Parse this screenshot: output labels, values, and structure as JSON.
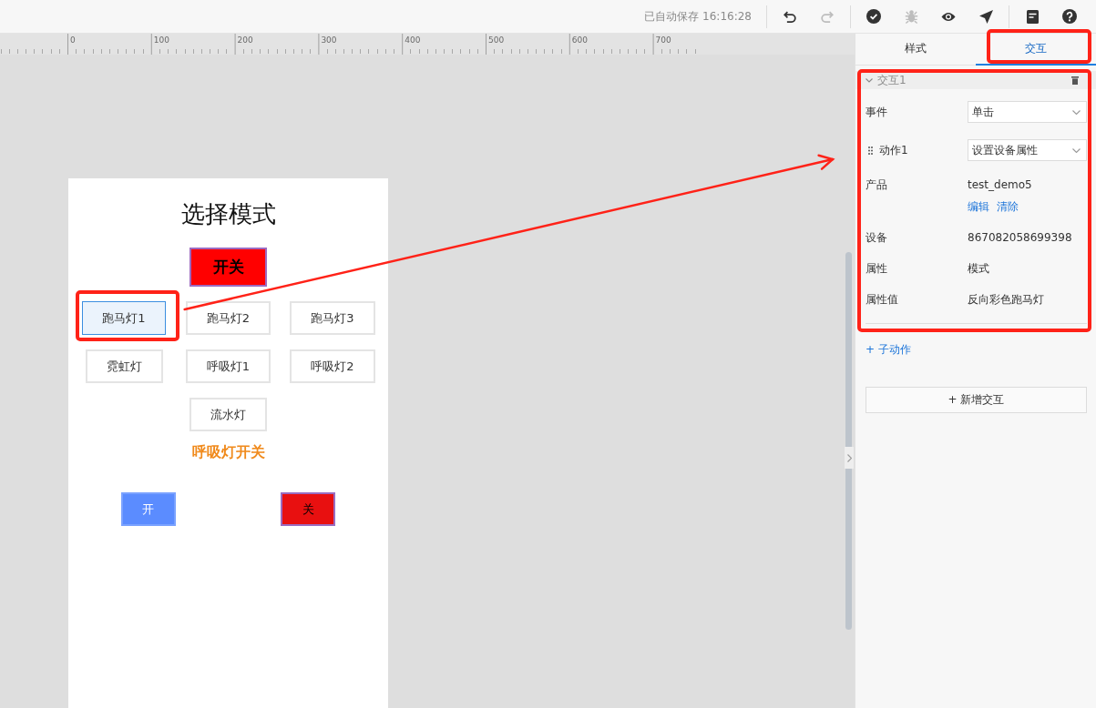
{
  "toolbar": {
    "autosave": "已自动保存 16:16:28",
    "groups": [
      [
        {
          "kind": "undo",
          "disabled": false
        },
        {
          "kind": "redo",
          "disabled": true
        }
      ],
      [
        {
          "kind": "check",
          "disabled": false
        },
        {
          "kind": "bug",
          "disabled": true
        },
        {
          "kind": "eye",
          "disabled": false
        },
        {
          "kind": "send",
          "disabled": false
        }
      ],
      [
        {
          "kind": "document",
          "disabled": false
        },
        {
          "kind": "help",
          "disabled": false
        }
      ]
    ]
  },
  "ruler": {
    "labels": [
      "0",
      "100",
      "200",
      "300",
      "400",
      "500",
      "600",
      "700"
    ]
  },
  "page": {
    "title": "选择模式",
    "power_button": "开关",
    "mode_rows": [
      [
        {
          "label": "跑马灯1",
          "selected": true,
          "highlighted": true
        },
        {
          "label": "跑马灯2",
          "selected": false,
          "highlighted": false
        },
        {
          "label": "跑马灯3",
          "selected": false,
          "highlighted": false
        }
      ],
      [
        {
          "label": "霓虹灯",
          "selected": false,
          "highlighted": false
        },
        {
          "label": "呼吸灯1",
          "selected": false,
          "highlighted": false
        },
        {
          "label": "呼吸灯2",
          "selected": false,
          "highlighted": false
        }
      ],
      [
        {
          "label": "流水灯",
          "selected": false,
          "highlighted": false
        }
      ]
    ],
    "breath_title": "呼吸灯开关",
    "breath_buttons": [
      {
        "kind": "on",
        "label": "开",
        "color": "#5b8cff"
      },
      {
        "kind": "off",
        "label": "关",
        "color": "#e81010"
      }
    ]
  },
  "panel": {
    "tabs": [
      {
        "label": "样式",
        "selected": false,
        "highlighted": false
      },
      {
        "label": "交互",
        "selected": true,
        "highlighted": true
      }
    ],
    "interaction": {
      "title": "交互1",
      "expanded": true,
      "highlighted": true,
      "fields": [
        {
          "kind": "select",
          "label": "事件",
          "value": "单击",
          "draggable": false
        },
        {
          "kind": "select",
          "label": "动作1",
          "value": "设置设备属性",
          "draggable": true
        },
        {
          "kind": "text",
          "label": "产品",
          "value": "test_demo5",
          "links": [
            "编辑",
            "清除"
          ],
          "draggable": false
        },
        {
          "kind": "text",
          "label": "设备",
          "value": "867082058699398",
          "draggable": false
        },
        {
          "kind": "text",
          "label": "属性",
          "value": "模式",
          "draggable": false
        },
        {
          "kind": "text",
          "label": "属性值",
          "value": "反向彩色跑马灯",
          "draggable": false
        }
      ]
    },
    "sub_action_link": "+ 子动作",
    "add_button": "+ 新增交互"
  },
  "annotation_arrow": true
}
